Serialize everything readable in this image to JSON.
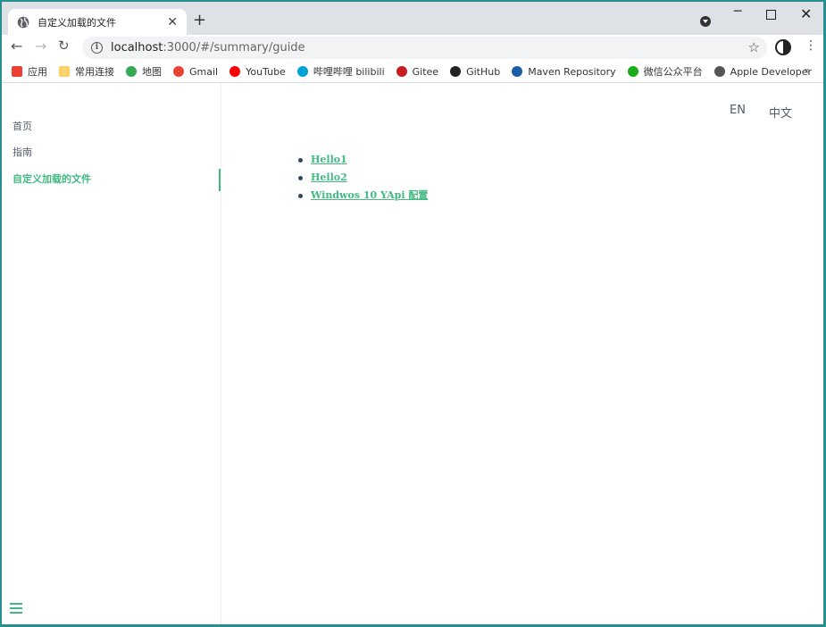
{
  "browser": {
    "tab_title": "自定义加载的文件",
    "tab_close": "✕",
    "new_tab": "+",
    "url_host": "localhost",
    "url_rest": ":3000/#/summary/guide",
    "bookmarks": [
      {
        "label": "应用",
        "icon": "apps-grid-icon",
        "color": "#e94235"
      },
      {
        "label": "常用连接",
        "icon": "folder-icon",
        "color": "#fbd36b"
      },
      {
        "label": "地图",
        "icon": "maps-pin-icon",
        "color": "#34a853"
      },
      {
        "label": "Gmail",
        "icon": "gmail-icon",
        "color": "#ea4335"
      },
      {
        "label": "YouTube",
        "icon": "youtube-icon",
        "color": "#ff0000"
      },
      {
        "label": "哔哩哔哩 bilibili",
        "icon": "bilibili-icon",
        "color": "#00a1d6"
      },
      {
        "label": "Gitee",
        "icon": "gitee-icon",
        "color": "#c71d23"
      },
      {
        "label": "GitHub",
        "icon": "github-icon",
        "color": "#222222"
      },
      {
        "label": "Maven Repository",
        "icon": "maven-icon",
        "color": "#1a5ea8"
      },
      {
        "label": "微信公众平台",
        "icon": "wechat-icon",
        "color": "#1aad19"
      },
      {
        "label": "Apple Developer",
        "icon": "apple-icon",
        "color": "#555555"
      }
    ],
    "bookmarks_more": "»"
  },
  "sidebar": {
    "items": [
      {
        "label": "首页",
        "active": false
      },
      {
        "label": "指南",
        "active": false
      },
      {
        "label": "自定义加载的文件",
        "active": true
      }
    ]
  },
  "langnav": {
    "en": "EN",
    "zh": "中文"
  },
  "content": {
    "links": [
      "Hello1",
      "Hello2",
      "Windwos 10 YApi 配置"
    ]
  },
  "colors": {
    "accent": "#42b983",
    "text": "#505d6b"
  }
}
